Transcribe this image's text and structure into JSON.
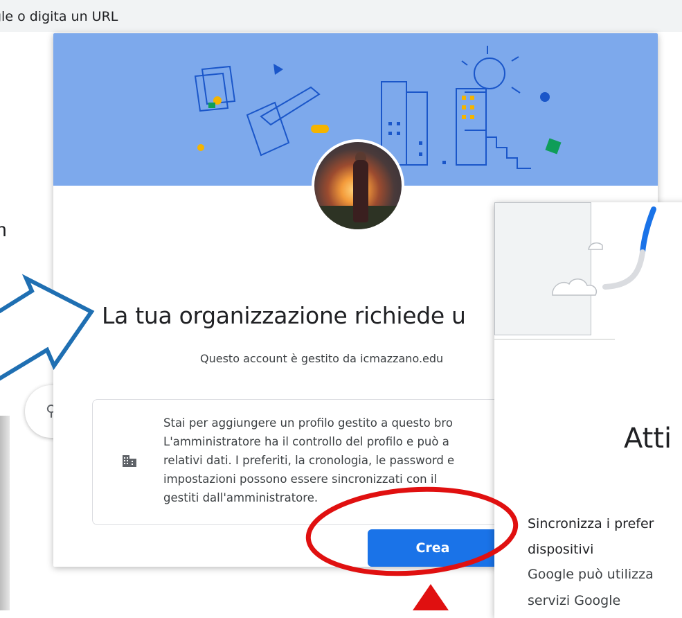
{
  "browser": {
    "omnibox_text": "gle o digita un URL"
  },
  "background_page": {
    "partial_letter": "n",
    "search_glyph": "search-icon"
  },
  "dialog": {
    "title": "La tua organizzazione richiede u",
    "subtitle": "Questo account è gestito da icmazzano.edu",
    "info_lines": [
      "Stai per aggiungere un profilo gestito a questo bro",
      "L'amministratore ha il controllo del profilo e può a",
      "relativi dati. I preferiti, la cronologia, le password e",
      "impostazioni possono essere sincronizzati con il",
      "gestiti dall'amministratore."
    ],
    "info_icon": "building-icon",
    "create_button": "Crea",
    "accent_color": "#1a73e8",
    "banner_color": "#7da9ec"
  },
  "sync_dialog": {
    "title": "Atti",
    "lines": [
      "Sincronizza i prefer",
      "dispositivi",
      "Google può utilizza",
      "servizi Google"
    ]
  },
  "annotations": {
    "arrow_color": "#1f6fb2",
    "ellipse_color": "#e01010"
  }
}
